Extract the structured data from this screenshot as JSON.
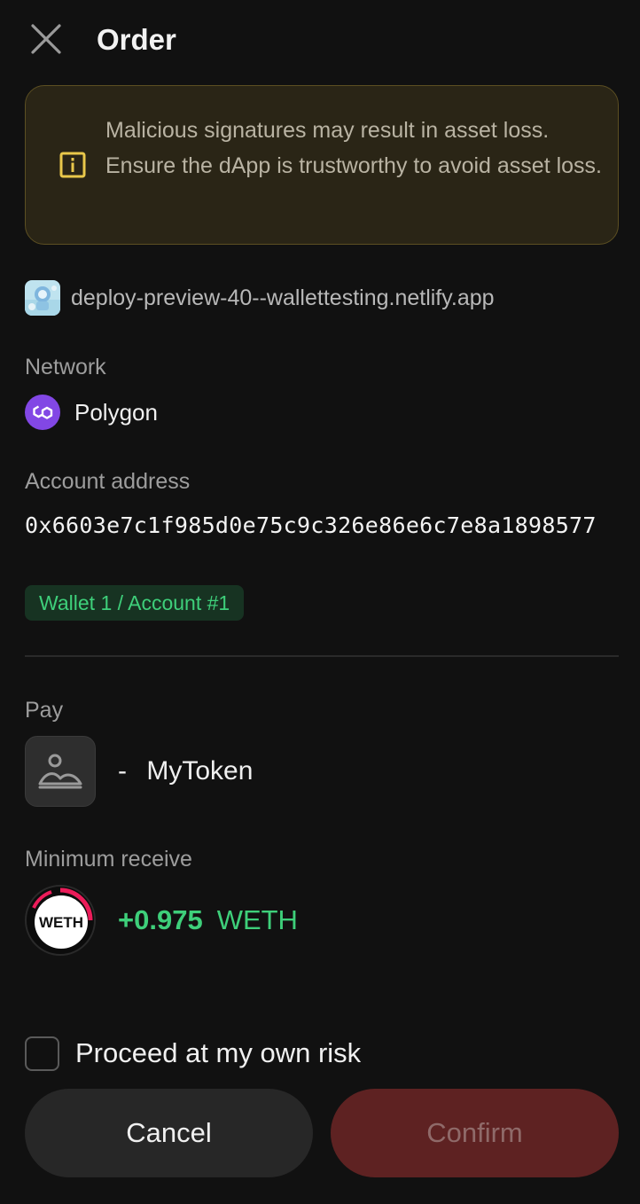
{
  "header": {
    "title": "Order"
  },
  "warning": {
    "text": "Malicious signatures may result in asset loss. Ensure the dApp is trustworthy to avoid asset loss.",
    "accent_color": "#e9c84b"
  },
  "origin": {
    "host": "deploy-preview-40--wallettesting.netlify.app"
  },
  "network": {
    "label": "Network",
    "name": "Polygon",
    "color": "#8247e5"
  },
  "account": {
    "label": "Account address",
    "address": "0x6603e7c1f985d0e75c9c326e86e6c7e8a1898577",
    "wallet_badge": "Wallet 1 / Account #1"
  },
  "pay": {
    "label": "Pay",
    "dash": "-",
    "token_name": "MyToken"
  },
  "receive": {
    "label": "Minimum receive",
    "amount": "+0.975",
    "symbol": "WETH",
    "logo_text": "WETH",
    "color": "#3ecf7a"
  },
  "risk": {
    "label": "Proceed at my own risk",
    "checked": false
  },
  "actions": {
    "cancel_label": "Cancel",
    "confirm_label": "Confirm",
    "confirm_disabled": true
  }
}
